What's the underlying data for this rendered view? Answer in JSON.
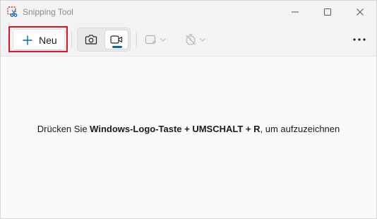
{
  "window": {
    "title": "Snipping Tool"
  },
  "toolbar": {
    "new_label": "Neu",
    "capture_modes": [
      {
        "name": "snip-mode",
        "icon": "camera-icon",
        "selected": false
      },
      {
        "name": "record-mode",
        "icon": "video-camera-icon",
        "selected": true
      }
    ],
    "shape_dropdown_icon": "rectangle-snip-icon",
    "timer_dropdown_icon": "timer-off-icon",
    "more_icon": "more-horizontal-icon"
  },
  "content": {
    "hint_prefix": "Drücken Sie ",
    "hint_shortcut": "Windows-Logo-Taste + UMSCHALT + R",
    "hint_suffix": ", um aufzuzeichnen"
  },
  "colors": {
    "highlight": "#e8121c",
    "accent": "#0067c0"
  }
}
